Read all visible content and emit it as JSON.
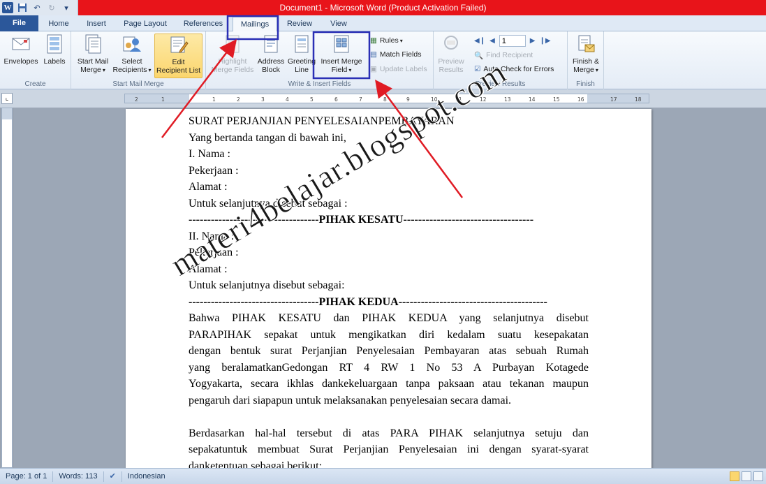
{
  "app": {
    "title": "Document1 - Microsoft Word (Product Activation Failed)",
    "logo_letter": "W"
  },
  "quick_access": {
    "icons": [
      "save-icon",
      "undo-icon",
      "redo-icon",
      "customize-icon"
    ]
  },
  "tabs": [
    {
      "label": "File"
    },
    {
      "label": "Home"
    },
    {
      "label": "Insert"
    },
    {
      "label": "Page Layout"
    },
    {
      "label": "References"
    },
    {
      "label": "Mailings"
    },
    {
      "label": "Review"
    },
    {
      "label": "View"
    }
  ],
  "active_tab": "Mailings",
  "ribbon": {
    "create": {
      "label": "Create",
      "envelopes": "Envelopes",
      "labels": "Labels"
    },
    "start_mail_merge": {
      "label": "Start Mail Merge",
      "start_l1": "Start Mail",
      "start_l2": "Merge",
      "select_l1": "Select",
      "select_l2": "Recipients",
      "edit_l1": "Edit",
      "edit_l2": "Recipient List"
    },
    "write_insert": {
      "label": "Write & Insert Fields",
      "highlight_l1": "Highlight",
      "highlight_l2": "Merge Fields",
      "address_l1": "Address",
      "address_l2": "Block",
      "greeting_l1": "Greeting",
      "greeting_l2": "Line",
      "insert_l1": "Insert Merge",
      "insert_l2": "Field",
      "rules": "Rules",
      "match_fields": "Match Fields",
      "update_labels": "Update Labels"
    },
    "preview": {
      "label": "Preview Results",
      "preview_l1": "Preview",
      "preview_l2": "Results",
      "record_value": "1",
      "find_recipient": "Find Recipient",
      "auto_check": "Auto Check for Errors"
    },
    "finish": {
      "label": "Finish",
      "finish_l1": "Finish &",
      "finish_l2": "Merge"
    }
  },
  "ruler": {
    "ticks": [
      "2",
      "1",
      "1",
      "2",
      "3",
      "4",
      "5",
      "6",
      "7",
      "8",
      "9",
      "10",
      "11",
      "12",
      "13",
      "14",
      "15",
      "16",
      "17",
      "18"
    ]
  },
  "document": {
    "lines": [
      "SURAT PERJANJIAN PENYELESAIANPEMBAYARAN",
      "Yang bertanda tangan di bawah ini,",
      "I. Nama :",
      "Pekerjaan :",
      "Alamat :",
      "Untuk selanjutnya disebut sebagai :"
    ],
    "divider1_left": "-----------------------------------",
    "divider1_center": "PIHAK  KESATU",
    "divider1_right": "-----------------------------------",
    "lines2": [
      "II. Nama :",
      "Pekerjaan :",
      "Alamat :",
      "Untuk selanjutnya disebut sebagai:"
    ],
    "divider2_left": "-----------------------------------",
    "divider2_center": "PIHAK  KEDUA",
    "divider2_right": "----------------------------------------",
    "para1": [
      "Bahwa PIHAK KESATU dan PIHAK KEDUA yang selanjutnya disebut",
      "PARAPIHAK sepakat untuk mengikatkan diri kedalam suatu kesepakatan",
      "dengan bentuk surat Perjanjian Penyelesaian Pembayaran atas sebuah Rumah",
      "yang beralamatkanGedongan RT 4 RW 1 No 53 A Purbayan Kotagede",
      "Yogyakarta, secara ikhlas dankekeluargaan tanpa paksaan atau tekanan maupun",
      "pengaruh dari siapapun untuk melaksanakan penyelesaian secara damai."
    ],
    "para2": [
      "Berdasarkan hal-hal tersebut di atas PARA PIHAK selanjutnya setuju dan",
      "sepakatuntuk membuat Surat Perjanjian Penyelesaian ini dengan syarat-syarat",
      "danketentuan sebagai berikut:"
    ]
  },
  "watermark": "materi4belajar.blogspot.com",
  "status": {
    "page": "Page: 1 of 1",
    "words": "Words: 113",
    "language": "Indonesian"
  },
  "colors": {
    "title_bar": "#e8141a",
    "file_tab": "#2b579a",
    "highlight_box": "#2a2fb5",
    "arrow": "#e01b24"
  }
}
